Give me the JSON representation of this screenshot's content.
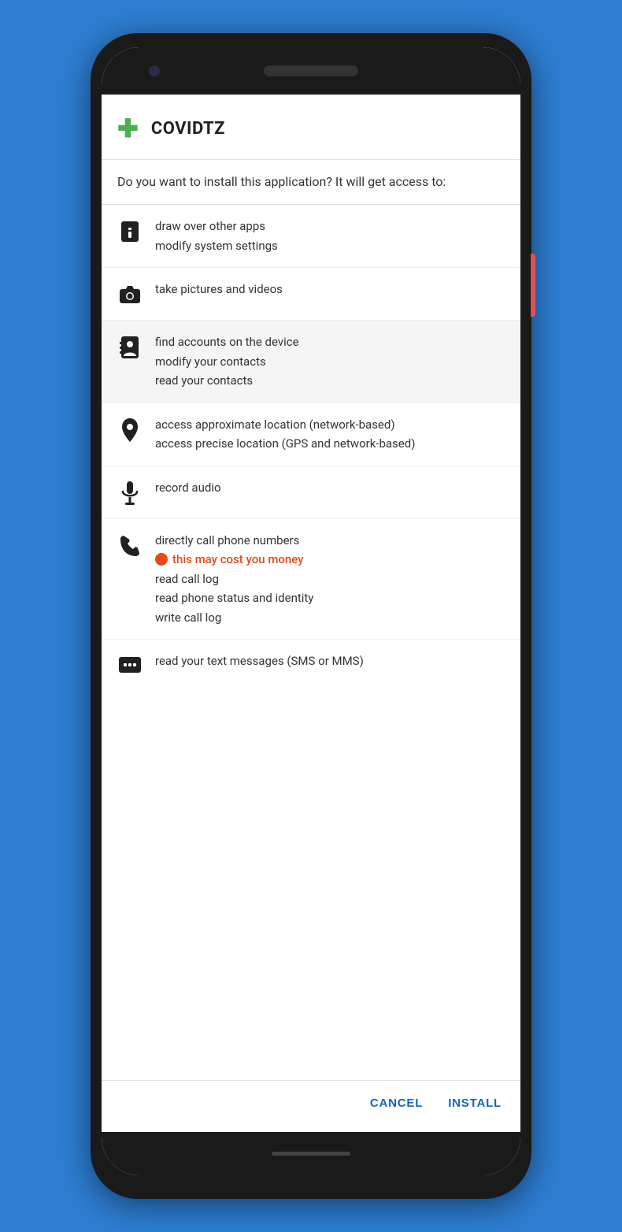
{
  "phone": {
    "background_color": "#2d7dd2"
  },
  "app": {
    "icon": "✚",
    "name": "COVIDTZ",
    "install_prompt": "Do you want to install this application? It will get access to:"
  },
  "permissions": [
    {
      "icon_name": "info-icon",
      "icon_symbol": "info",
      "texts": [
        "draw over other apps",
        "modify system settings"
      ],
      "warning": null
    },
    {
      "icon_name": "camera-icon",
      "icon_symbol": "camera",
      "texts": [
        "take pictures and videos"
      ],
      "warning": null
    },
    {
      "icon_name": "contacts-icon",
      "icon_symbol": "contacts",
      "texts": [
        "find accounts on the device",
        "modify your contacts",
        "read your contacts"
      ],
      "warning": null
    },
    {
      "icon_name": "location-icon",
      "icon_symbol": "location",
      "texts": [
        "access approximate location (network-based)",
        "access precise location (GPS and network-based)"
      ],
      "warning": null
    },
    {
      "icon_name": "microphone-icon",
      "icon_symbol": "microphone",
      "texts": [
        "record audio"
      ],
      "warning": null
    },
    {
      "icon_name": "phone-icon",
      "icon_symbol": "phone",
      "texts": [
        "directly call phone numbers",
        "read call log",
        "read phone status and identity",
        "write call log"
      ],
      "warning": "this may cost you money"
    },
    {
      "icon_name": "sms-icon",
      "icon_symbol": "sms",
      "texts": [
        "read your text messages (SMS or MMS)"
      ],
      "warning": null
    }
  ],
  "actions": {
    "cancel_label": "CANCEL",
    "install_label": "INSTALL"
  }
}
